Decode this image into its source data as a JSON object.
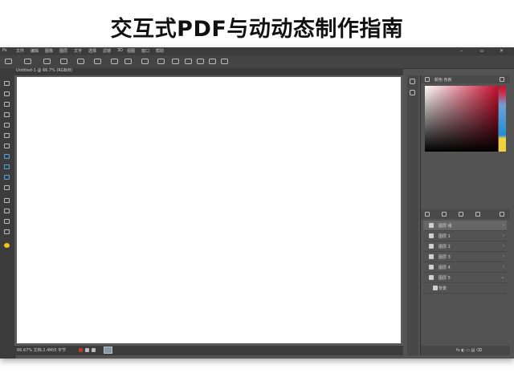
{
  "banner": {
    "title": "交互式PDF与动动态制作指南"
  },
  "menubar": {
    "items": [
      "Ps",
      "文件",
      "编辑",
      "图像",
      "图层",
      "文字",
      "选择",
      "滤镜",
      "3D",
      "视图",
      "窗口",
      "帮助"
    ],
    "window_controls": [
      "–",
      "▫",
      "✕"
    ]
  },
  "document": {
    "tab_label": "Untitled-1 @ 66.7% (RGB/8)"
  },
  "statusbar": {
    "zoom_text": "66.67%  文档:2.4M/0 字节"
  },
  "right_panel": {
    "color_panel_label": "颜色  色板",
    "colors": {
      "accent_red": "#c8102e",
      "hue_blue": "#1e8fd6",
      "hue_yellow": "#f4d03f"
    },
    "layers": [
      {
        "label": "图层 组",
        "selected": true
      },
      {
        "label": "图层 1"
      },
      {
        "label": "图层 2"
      },
      {
        "label": "图层 3"
      },
      {
        "label": "图层 4"
      },
      {
        "label": "图层 5"
      },
      {
        "label": "背景"
      }
    ],
    "bottom_text": "fx  ◐  ▭  ▤  ⌫"
  },
  "icons": [
    "move-icon",
    "marquee-icon",
    "lasso-icon",
    "crop-icon",
    "brush-icon",
    "eraser-icon",
    "type-icon",
    "zoom-icon",
    "hand-icon"
  ]
}
